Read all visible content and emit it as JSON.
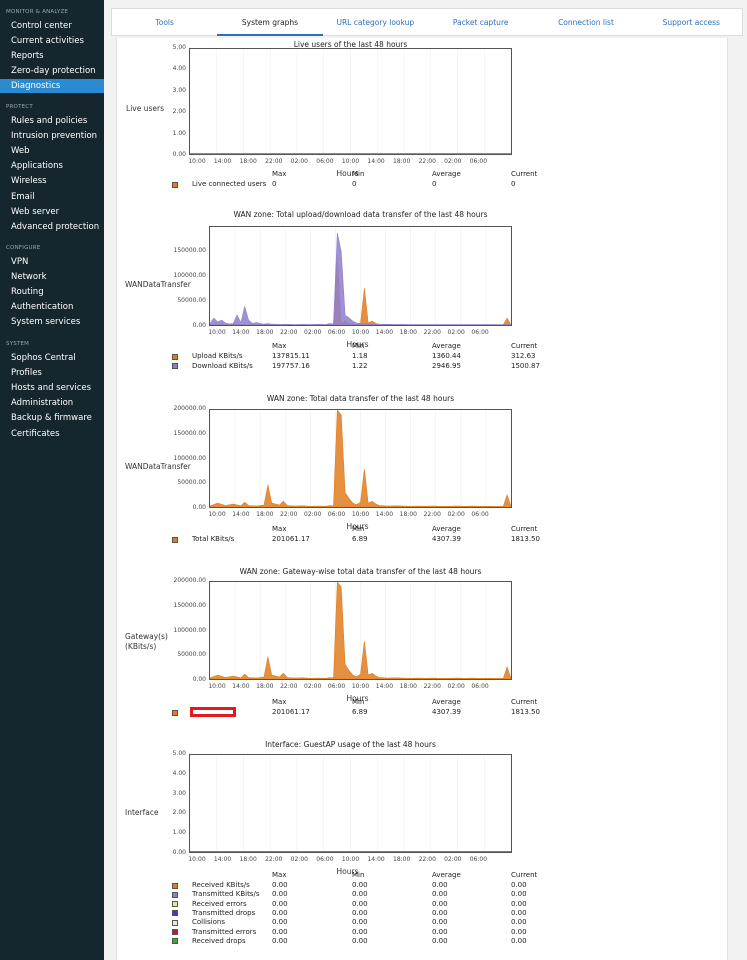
{
  "sidebar": {
    "sections": [
      {
        "title": "MONITOR & ANALYZE",
        "items": [
          "Control center",
          "Current activities",
          "Reports",
          "Zero-day protection",
          "Diagnostics"
        ]
      },
      {
        "title": "PROTECT",
        "items": [
          "Rules and policies",
          "Intrusion prevention",
          "Web",
          "Applications",
          "Wireless",
          "Email",
          "Web server",
          "Advanced protection"
        ]
      },
      {
        "title": "CONFIGURE",
        "items": [
          "VPN",
          "Network",
          "Routing",
          "Authentication",
          "System services"
        ]
      },
      {
        "title": "SYSTEM",
        "items": [
          "Sophos Central",
          "Profiles",
          "Hosts and services",
          "Administration",
          "Backup & firmware",
          "Certificates"
        ]
      }
    ],
    "active": "Diagnostics"
  },
  "tabs": [
    "Tools",
    "System graphs",
    "URL category lookup",
    "Packet capture",
    "Connection list",
    "Support access"
  ],
  "active_tab": "System graphs",
  "stat_headers": [
    "Max",
    "Min",
    "Average",
    "Current"
  ],
  "x_ticks": [
    "10:00",
    "14:00",
    "18:00",
    "22:00",
    "02:00",
    "06:00",
    "10:00",
    "14:00",
    "18:00",
    "22:00",
    "02:00",
    "06:00"
  ],
  "x_title": "Hours",
  "colors": {
    "sidebar": "#16262f",
    "active": "#2a8bd0",
    "upload": "#e07d1e",
    "download": "#8d7fd0"
  },
  "chart_data": [
    {
      "type": "line",
      "title": "Live users of the last 48 hours",
      "ylabel": "Live users",
      "ylim": [
        0,
        5
      ],
      "y_ticks": [
        "5.00",
        "4.00",
        "3.00",
        "2.00",
        "1.00",
        "0.00"
      ],
      "series": [
        {
          "name": "Live connected users",
          "color": "#e07d1e",
          "max": "0",
          "min": "0",
          "average": "0",
          "current": "0",
          "values": []
        }
      ]
    },
    {
      "type": "area",
      "title": "WAN zone: Total upload/download data transfer of the last 48 hours",
      "ylabel": "WANDataTransfer",
      "ylim": [
        0,
        200000
      ],
      "y_ticks": [
        "150000.00",
        "100000.00",
        "50000.00",
        "0.00"
      ],
      "series": [
        {
          "name": "Upload KBits/s",
          "color": "#e07d1e",
          "max": "137815.11",
          "min": "1.18",
          "average": "1360.44",
          "current": "312.63",
          "values": [
            [
              0,
              600
            ],
            [
              2,
              1500
            ],
            [
              4,
              900
            ],
            [
              6,
              2500
            ],
            [
              8,
              1200
            ],
            [
              10,
              900
            ],
            [
              12,
              600
            ],
            [
              14,
              2000
            ],
            [
              15,
              3000
            ],
            [
              16,
              1200
            ],
            [
              18,
              800
            ],
            [
              20,
              600
            ],
            [
              22,
              500
            ],
            [
              24,
              700
            ],
            [
              26,
              500
            ],
            [
              28,
              400
            ],
            [
              30,
              600
            ],
            [
              31,
              800
            ],
            [
              32,
              500
            ],
            [
              33,
              137815
            ],
            [
              34,
              3000
            ],
            [
              35,
              9000
            ],
            [
              36,
              2500
            ],
            [
              38,
              1500
            ],
            [
              39,
              3000
            ],
            [
              40,
              75000
            ],
            [
              41,
              4000
            ],
            [
              42,
              8000
            ],
            [
              43,
              3000
            ],
            [
              44,
              1500
            ],
            [
              46,
              600
            ],
            [
              48,
              800
            ],
            [
              50,
              500
            ],
            [
              52,
              400
            ],
            [
              54,
              600
            ],
            [
              56,
              500
            ],
            [
              58,
              400
            ],
            [
              60,
              300
            ],
            [
              62,
              400
            ],
            [
              64,
              500
            ],
            [
              66,
              400
            ],
            [
              68,
              300
            ],
            [
              70,
              500
            ],
            [
              72,
              600
            ],
            [
              74,
              400
            ],
            [
              76,
              500
            ],
            [
              77,
              14000
            ],
            [
              78,
              300
            ]
          ]
        },
        {
          "name": "Download KBits/s",
          "color": "#8d7fd0",
          "max": "197757.16",
          "min": "1.22",
          "average": "2946.95",
          "current": "1500.87",
          "values": [
            [
              0,
              3000
            ],
            [
              1,
              14000
            ],
            [
              2,
              6000
            ],
            [
              3,
              10000
            ],
            [
              4,
              4000
            ],
            [
              5,
              2000
            ],
            [
              6,
              3000
            ],
            [
              7,
              20000
            ],
            [
              8,
              5000
            ],
            [
              9,
              38000
            ],
            [
              10,
              10000
            ],
            [
              11,
              3000
            ],
            [
              12,
              5000
            ],
            [
              14,
              1500
            ],
            [
              16,
              2000
            ],
            [
              18,
              1000
            ],
            [
              20,
              1500
            ],
            [
              22,
              1000
            ],
            [
              24,
              1200
            ],
            [
              26,
              800
            ],
            [
              28,
              1500
            ],
            [
              30,
              1000
            ],
            [
              31,
              3000
            ],
            [
              32,
              2000
            ],
            [
              33,
              188000
            ],
            [
              34,
              150000
            ],
            [
              35,
              20000
            ],
            [
              36,
              15000
            ],
            [
              37,
              8000
            ],
            [
              38,
              4000
            ],
            [
              39,
              3000
            ],
            [
              40,
              2500
            ],
            [
              42,
              1500
            ],
            [
              44,
              1000
            ],
            [
              46,
              1500
            ],
            [
              48,
              1000
            ],
            [
              50,
              1200
            ],
            [
              52,
              900
            ],
            [
              54,
              1000
            ],
            [
              56,
              800
            ],
            [
              58,
              1000
            ],
            [
              60,
              900
            ],
            [
              62,
              800
            ],
            [
              64,
              1000
            ],
            [
              66,
              900
            ],
            [
              68,
              1000
            ],
            [
              70,
              800
            ],
            [
              72,
              1000
            ],
            [
              74,
              800
            ],
            [
              76,
              1000
            ],
            [
              77,
              1500
            ],
            [
              78,
              800
            ]
          ]
        }
      ]
    },
    {
      "type": "area",
      "title": "WAN zone: Total data transfer of the last 48 hours",
      "ylabel": "WANDataTransfer",
      "ylim": [
        0,
        200000
      ],
      "y_ticks": [
        "200000.00",
        "150000.00",
        "100000.00",
        "50000.00",
        "0.00"
      ],
      "series": [
        {
          "name": "Total KBits/s",
          "color": "#e07d1e",
          "max": "201061.17",
          "min": "6.89",
          "average": "4307.39",
          "current": "1813.50",
          "values": [
            [
              0,
              2000
            ],
            [
              2,
              8000
            ],
            [
              4,
              3000
            ],
            [
              6,
              6000
            ],
            [
              8,
              2500
            ],
            [
              9,
              10000
            ],
            [
              10,
              3000
            ],
            [
              12,
              2000
            ],
            [
              14,
              4000
            ],
            [
              15,
              46000
            ],
            [
              16,
              8000
            ],
            [
              18,
              4000
            ],
            [
              19,
              12000
            ],
            [
              20,
              3000
            ],
            [
              22,
              2000
            ],
            [
              24,
              2500
            ],
            [
              26,
              1500
            ],
            [
              28,
              2000
            ],
            [
              30,
              1500
            ],
            [
              31,
              3000
            ],
            [
              32,
              2000
            ],
            [
              33,
              201061
            ],
            [
              34,
              190000
            ],
            [
              35,
              30000
            ],
            [
              36,
              18000
            ],
            [
              37,
              8000
            ],
            [
              38,
              5000
            ],
            [
              39,
              10000
            ],
            [
              40,
              78000
            ],
            [
              41,
              8000
            ],
            [
              42,
              12000
            ],
            [
              43,
              6000
            ],
            [
              44,
              3000
            ],
            [
              46,
              2000
            ],
            [
              48,
              2500
            ],
            [
              50,
              1800
            ],
            [
              52,
              1500
            ],
            [
              54,
              1800
            ],
            [
              56,
              1500
            ],
            [
              58,
              1800
            ],
            [
              60,
              1200
            ],
            [
              62,
              1500
            ],
            [
              64,
              1800
            ],
            [
              66,
              1500
            ],
            [
              68,
              1800
            ],
            [
              70,
              1200
            ],
            [
              72,
              1500
            ],
            [
              74,
              1200
            ],
            [
              76,
              1500
            ],
            [
              77,
              25000
            ],
            [
              78,
              1800
            ]
          ]
        }
      ]
    },
    {
      "type": "area",
      "title": "WAN zone: Gateway-wise total data transfer of the last 48 hours",
      "ylabel": "Gateway(s) (KBits/s)",
      "ylim": [
        0,
        200000
      ],
      "y_ticks": [
        "200000.00",
        "150000.00",
        "100000.00",
        "50000.00",
        "0.00"
      ],
      "series": [
        {
          "name": "",
          "color": "#e07d1e",
          "max": "201061.17",
          "min": "6.89",
          "average": "4307.39",
          "current": "1813.50",
          "values": [
            [
              0,
              2000
            ],
            [
              2,
              8000
            ],
            [
              4,
              3000
            ],
            [
              6,
              6000
            ],
            [
              8,
              2500
            ],
            [
              9,
              10000
            ],
            [
              10,
              3000
            ],
            [
              12,
              2000
            ],
            [
              14,
              4000
            ],
            [
              15,
              46000
            ],
            [
              16,
              8000
            ],
            [
              18,
              4000
            ],
            [
              19,
              12000
            ],
            [
              20,
              3000
            ],
            [
              22,
              2000
            ],
            [
              24,
              2500
            ],
            [
              26,
              1500
            ],
            [
              28,
              2000
            ],
            [
              30,
              1500
            ],
            [
              31,
              3000
            ],
            [
              32,
              2000
            ],
            [
              33,
              201061
            ],
            [
              34,
              190000
            ],
            [
              35,
              30000
            ],
            [
              36,
              18000
            ],
            [
              37,
              8000
            ],
            [
              38,
              5000
            ],
            [
              39,
              10000
            ],
            [
              40,
              78000
            ],
            [
              41,
              8000
            ],
            [
              42,
              12000
            ],
            [
              43,
              6000
            ],
            [
              44,
              3000
            ],
            [
              46,
              2000
            ],
            [
              48,
              2500
            ],
            [
              50,
              1800
            ],
            [
              52,
              1500
            ],
            [
              54,
              1800
            ],
            [
              56,
              1500
            ],
            [
              58,
              1800
            ],
            [
              60,
              1200
            ],
            [
              62,
              1500
            ],
            [
              64,
              1800
            ],
            [
              66,
              1500
            ],
            [
              68,
              1800
            ],
            [
              70,
              1200
            ],
            [
              72,
              1500
            ],
            [
              74,
              1200
            ],
            [
              76,
              1500
            ],
            [
              77,
              25000
            ],
            [
              78,
              1800
            ]
          ]
        }
      ]
    },
    {
      "type": "line",
      "title": "Interface: GuestAP usage of the last 48 hours",
      "ylabel": "Interface",
      "ylim": [
        0,
        5
      ],
      "y_ticks": [
        "5.00",
        "4.00",
        "3.00",
        "2.00",
        "1.00",
        "0.00"
      ],
      "series": [
        {
          "name": "Received KBits/s",
          "color": "#e07d1e",
          "max": "0.00",
          "min": "0.00",
          "average": "0.00",
          "current": "0.00",
          "values": []
        },
        {
          "name": "Transmitted KBits/s",
          "color": "#8d7fd0",
          "max": "0.00",
          "min": "0.00",
          "average": "0.00",
          "current": "0.00",
          "values": []
        },
        {
          "name": "Received errors",
          "color": "#e8e89a",
          "max": "0.00",
          "min": "0.00",
          "average": "0.00",
          "current": "0.00",
          "values": []
        },
        {
          "name": "Transmitted drops",
          "color": "#3a3ad8",
          "max": "0.00",
          "min": "0.00",
          "average": "0.00",
          "current": "0.00",
          "values": []
        },
        {
          "name": "Collisions",
          "color": "#e6e6f0",
          "max": "0.00",
          "min": "0.00",
          "average": "0.00",
          "current": "0.00",
          "values": []
        },
        {
          "name": "Transmitted errors",
          "color": "#c21a1a",
          "max": "0.00",
          "min": "0.00",
          "average": "0.00",
          "current": "0.00",
          "values": []
        },
        {
          "name": "Received drops",
          "color": "#3aa83a",
          "max": "0.00",
          "min": "0.00",
          "average": "0.00",
          "current": "0.00",
          "values": []
        }
      ]
    }
  ]
}
